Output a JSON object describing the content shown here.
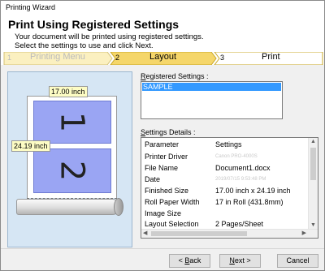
{
  "window": {
    "title": "Printing Wizard"
  },
  "header": {
    "title": "Print Using Registered Settings",
    "line1": "Your document will be printed using registered settings.",
    "line2": "Select the settings to use and click Next."
  },
  "steps": [
    {
      "num": "1",
      "label": "Printing Menu",
      "state": "done"
    },
    {
      "num": "2",
      "label": "Layout",
      "state": "active"
    },
    {
      "num": "3",
      "label": "Print",
      "state": "pending"
    }
  ],
  "preview": {
    "width_label": "17.00 inch",
    "height_label": "24.19 inch",
    "pages": [
      "1",
      "2"
    ]
  },
  "registered": {
    "label_prefix": "",
    "label_underlined": "R",
    "label_rest": "egistered Settings :",
    "items": [
      "SAMPLE"
    ]
  },
  "details": {
    "label_underlined": "S",
    "label_rest": "ettings Details :",
    "columns": [
      "Parameter",
      "Settings"
    ],
    "rows": [
      {
        "param": "Printer Driver",
        "value": "Canon PRO-4000S",
        "blurred": true
      },
      {
        "param": "File Name",
        "value": "Document1.docx",
        "blurred": false
      },
      {
        "param": "Date",
        "value": "2019/07/15 9:53:48 PM",
        "blurred": true
      },
      {
        "param": "Finished Size",
        "value": "17.00 inch x 24.19 inch",
        "blurred": false
      },
      {
        "param": "Roll Paper Width",
        "value": "17 in Roll (431.8mm)",
        "blurred": false
      },
      {
        "param": "Image Size",
        "value": "",
        "blurred": false
      },
      {
        "param": "Layout Selection",
        "value": "2 Pages/Sheet",
        "blurred": false
      }
    ]
  },
  "buttons": {
    "back": {
      "pre": "< ",
      "u": "B",
      "rest": "ack"
    },
    "next": {
      "pre": "",
      "u": "N",
      "rest": "ext >"
    },
    "cancel": {
      "label": "Cancel"
    }
  },
  "colors": {
    "step_active": "#f5d66a",
    "step_done": "#fbf0c0",
    "selection": "#3399ff",
    "preview_bg": "#d6e6f4",
    "page_fill": "#9aa5f3"
  }
}
